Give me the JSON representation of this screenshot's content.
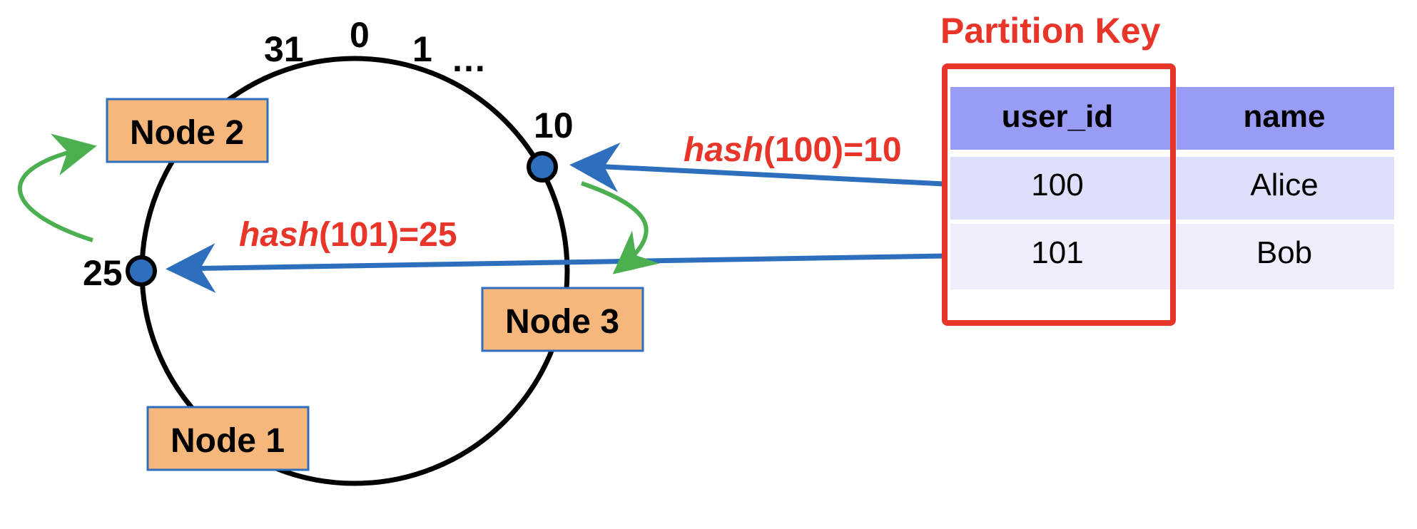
{
  "colors": {
    "accent_red": "#e8352a",
    "arrow_blue": "#2e6fbd",
    "arrow_green": "#4caf50",
    "node_fill": "#f5b77b",
    "node_border": "#2e6fbd",
    "point_fill": "#2e6fbd",
    "table_header": "#999cf5",
    "table_row": "#dedffa",
    "table_row_alt": "#eeeefc"
  },
  "ring": {
    "labels": {
      "l31": "31",
      "l0": "0",
      "l1": "1",
      "ellipsis": "…",
      "l10": "10",
      "l25": "25"
    }
  },
  "nodes": {
    "node1": "Node 1",
    "node2": "Node 2",
    "node3": "Node 3"
  },
  "hashes": {
    "h100": {
      "fn": "hash",
      "rest": "(100)=10"
    },
    "h101": {
      "fn": "hash",
      "rest": "(101)=25"
    }
  },
  "partition_key_label": "Partition Key",
  "table": {
    "headers": [
      "user_id",
      "name"
    ],
    "rows": [
      [
        "100",
        "Alice"
      ],
      [
        "101",
        "Bob"
      ]
    ]
  }
}
